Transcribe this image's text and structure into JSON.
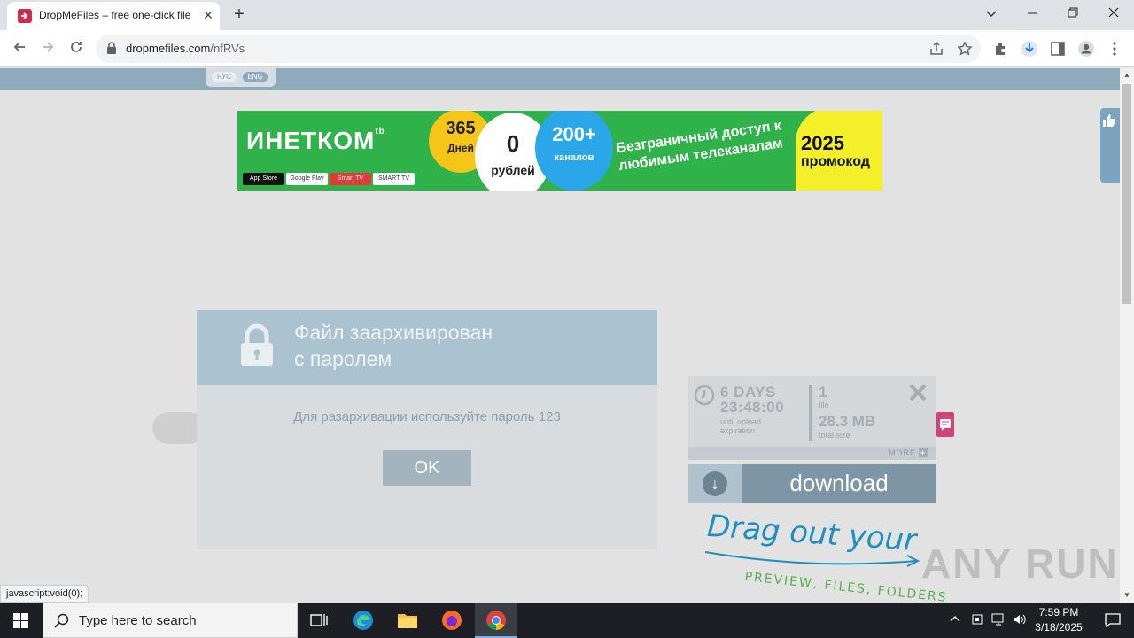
{
  "browser": {
    "tab_title": "DropMeFiles – free one-click file",
    "tab_close": "✕",
    "new_tab": "+",
    "url_host": "dropmefiles.com",
    "url_path": "/nfRVs",
    "status_url": "javascript:void(0);"
  },
  "lang": {
    "rus": "РУС",
    "eng": "ENG"
  },
  "banner": {
    "logo": "ИНЕТКОМ",
    "logo_sup": "tb",
    "stores": [
      "App Store",
      "Google Play",
      "Smart TV",
      "SMART TV"
    ],
    "circle1_big": "365",
    "circle1_small": "Дней",
    "circle2_big": "0",
    "circle2_small": "рублей",
    "circle3_big": "200+",
    "circle3_small": "каналов",
    "text": "Безграничный доступ к любимым телеканалам",
    "promo_year": "2025",
    "promo_word": "промокод"
  },
  "modal": {
    "title_line1": "Файл заархивирован",
    "title_line2": "с паролем",
    "message": "Для разархивации используйте пароль 123",
    "ok_label": "OK"
  },
  "info": {
    "days": "6 DAYS",
    "time": "23:48:00",
    "until1": "until upload",
    "until2": "expiration",
    "file_count": "1",
    "file_label": "file",
    "size": "28.3 MB",
    "size_label": "total size",
    "more": "MORE",
    "more_icon": "+"
  },
  "download": {
    "label": "download",
    "arrow": "↓"
  },
  "drag": {
    "main": "Drag out your",
    "sub": "PREVIEW, FILES, FOLDERS"
  },
  "watermark": "ANY RUN",
  "taskbar": {
    "search_placeholder": "Type here to search",
    "time": "7:59 PM",
    "date": "3/18/2025"
  },
  "colors": {
    "topband": "#8eaabb",
    "modal_head": "#abc3d0",
    "download_btn": "#7d95a4",
    "banner_green": "#2fb24a"
  }
}
